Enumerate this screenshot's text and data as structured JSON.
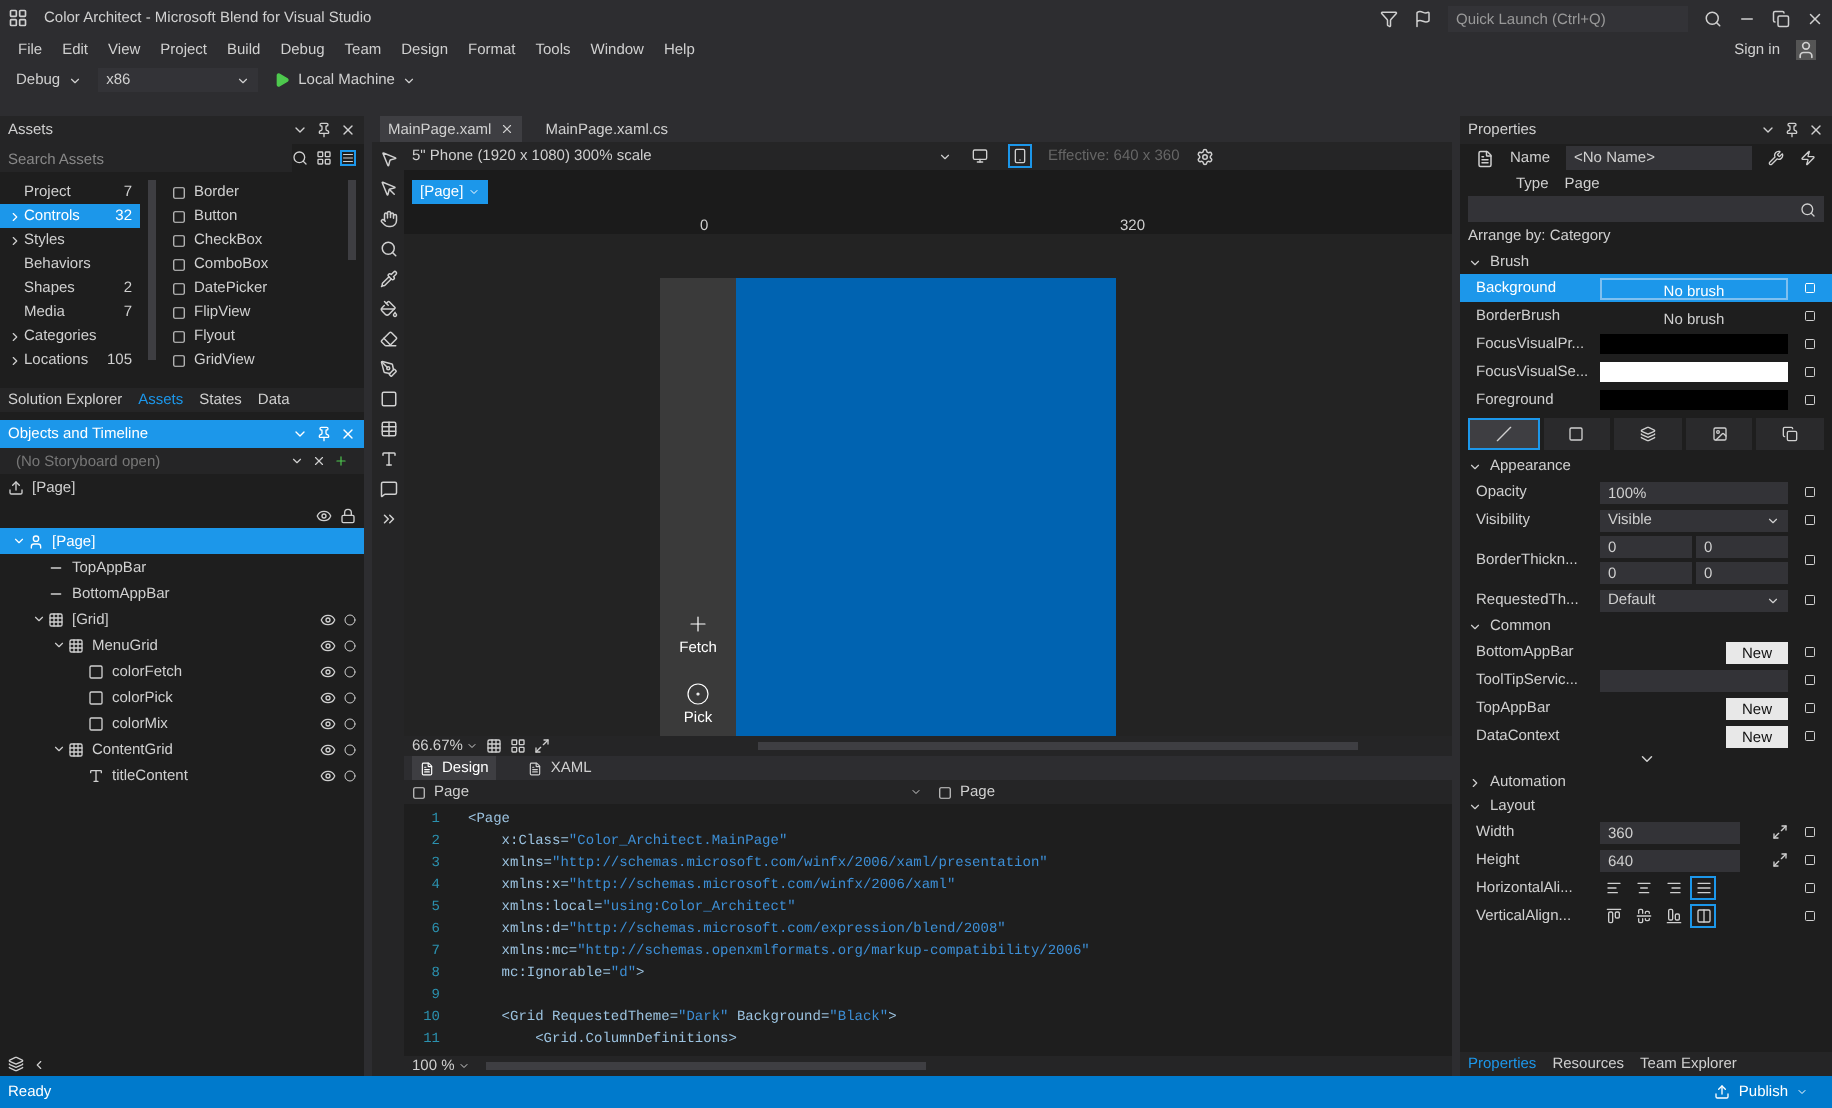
{
  "window": {
    "title": "Color Architect - Microsoft Blend for Visual Studio",
    "quick_launch_placeholder": "Quick Launch (Ctrl+Q)",
    "sign_in": "Sign in"
  },
  "menu": [
    "File",
    "Edit",
    "View",
    "Project",
    "Build",
    "Debug",
    "Team",
    "Design",
    "Format",
    "Tools",
    "Window",
    "Help"
  ],
  "toolbar": {
    "configuration": "Debug",
    "platform": "x86",
    "run_target": "Local Machine"
  },
  "assets": {
    "title": "Assets",
    "search_placeholder": "Search Assets",
    "categories": [
      {
        "label": "Project",
        "count": "7",
        "expandable": false,
        "selected": false
      },
      {
        "label": "Controls",
        "count": "32",
        "expandable": true,
        "selected": true
      },
      {
        "label": "Styles",
        "expandable": true,
        "selected": false
      },
      {
        "label": "Behaviors",
        "expandable": false,
        "selected": false
      },
      {
        "label": "Shapes",
        "count": "2",
        "expandable": false,
        "selected": false
      },
      {
        "label": "Media",
        "count": "7",
        "expandable": false,
        "selected": false
      },
      {
        "label": "Categories",
        "expandable": true,
        "selected": false
      },
      {
        "label": "Locations",
        "count": "105",
        "expandable": true,
        "selected": false
      }
    ],
    "items": [
      "Border",
      "Button",
      "CheckBox",
      "ComboBox",
      "DatePicker",
      "FlipView",
      "Flyout",
      "GridView"
    ],
    "tabs": [
      {
        "label": "Solution Explorer",
        "selected": false
      },
      {
        "label": "Assets",
        "selected": true
      },
      {
        "label": "States",
        "selected": false
      },
      {
        "label": "Data",
        "selected": false
      }
    ]
  },
  "objects": {
    "title": "Objects and Timeline",
    "storyboard": "(No Storyboard open)",
    "scope": "[Page]",
    "tree": [
      {
        "label": "[Page]",
        "kind": "page",
        "selected": true,
        "children": [
          {
            "label": "TopAppBar",
            "kind": "property",
            "selected": false
          },
          {
            "label": "BottomAppBar",
            "kind": "property",
            "selected": false
          },
          {
            "label": "[Grid]",
            "kind": "grid",
            "selected": false,
            "children": [
              {
                "label": "MenuGrid",
                "kind": "grid",
                "selected": false,
                "children": [
                  {
                    "label": "colorFetch",
                    "kind": "button",
                    "selected": false
                  },
                  {
                    "label": "colorPick",
                    "kind": "button",
                    "selected": false
                  },
                  {
                    "label": "colorMix",
                    "kind": "button",
                    "selected": false
                  }
                ]
              },
              {
                "label": "ContentGrid",
                "kind": "grid",
                "selected": false,
                "children": [
                  {
                    "label": "titleContent",
                    "kind": "text",
                    "selected": false
                  }
                ]
              }
            ]
          }
        ]
      }
    ]
  },
  "document_tabs": [
    {
      "label": "MainPage.xaml",
      "selected": true
    },
    {
      "label": "MainPage.xaml.cs",
      "selected": false
    }
  ],
  "designer": {
    "device": "5\" Phone (1920 x 1080) 300% scale",
    "orientations": [
      {
        "kind": "landscape",
        "selected": false
      },
      {
        "kind": "portrait",
        "selected": true
      }
    ],
    "effective": "Effective: 640 x 360",
    "element": "[Page]",
    "ruler": [
      "0",
      "320"
    ],
    "app_bar": [
      {
        "label": "Fetch",
        "kind": "add"
      },
      {
        "label": "Pick",
        "kind": "target"
      }
    ],
    "zoom": "66.67%"
  },
  "view_tabs": [
    {
      "label": "Design",
      "selected": true
    },
    {
      "label": "XAML",
      "selected": false
    }
  ],
  "code": {
    "scope_left": "Page",
    "scope_right": "Page",
    "zoom": "100 %",
    "lines": [
      {
        "number": "1",
        "text": "<Page"
      },
      {
        "number": "2",
        "text": "    x:Class=\"Color_Architect.MainPage\""
      },
      {
        "number": "3",
        "text": "    xmlns=\"http://schemas.microsoft.com/winfx/2006/xaml/presentation\""
      },
      {
        "number": "4",
        "text": "    xmlns:x=\"http://schemas.microsoft.com/winfx/2006/xaml\""
      },
      {
        "number": "5",
        "text": "    xmlns:local=\"using:Color_Architect\""
      },
      {
        "number": "6",
        "text": "    xmlns:d=\"http://schemas.microsoft.com/expression/blend/2008\""
      },
      {
        "number": "7",
        "text": "    xmlns:mc=\"http://schemas.openxmlformats.org/markup-compatibility/2006\""
      },
      {
        "number": "8",
        "text": "    mc:Ignorable=\"d\">"
      },
      {
        "number": "9"
      },
      {
        "number": "10",
        "text": "    <Grid RequestedTheme=\"Dark\" Background=\"Black\">"
      },
      {
        "number": "11",
        "text": "        <Grid.ColumnDefinitions>"
      }
    ]
  },
  "properties": {
    "title": "Properties",
    "name_label": "Name",
    "name_value": "<No Name>",
    "type_label": "Type",
    "type_value": "Page",
    "arrange": "Arrange by: Category",
    "sections": [
      {
        "title": "Brush",
        "expanded": true,
        "rows": [
          {
            "label": "Background",
            "kind": "text",
            "value": "No brush",
            "selected": true
          },
          {
            "label": "BorderBrush",
            "kind": "text",
            "value": "No brush",
            "selected": false
          },
          {
            "label": "FocusVisualPr...",
            "kind": "swatch",
            "color": "#000000",
            "selected": false
          },
          {
            "label": "FocusVisualSe...",
            "kind": "swatch",
            "color": "#ffffff",
            "selected": false
          },
          {
            "label": "Foreground",
            "kind": "swatch",
            "color": "#000000",
            "selected": false
          }
        ],
        "brush_tabs": [
          {
            "kind": "none",
            "selected": true
          },
          {
            "kind": "solid",
            "selected": false
          },
          {
            "kind": "gradient",
            "selected": false
          },
          {
            "kind": "image",
            "selected": false
          },
          {
            "kind": "resource",
            "selected": false
          }
        ]
      },
      {
        "title": "Appearance",
        "expanded": true,
        "rows": [
          {
            "label": "Opacity",
            "kind": "field",
            "value": "100%"
          },
          {
            "label": "Visibility",
            "kind": "dropdown",
            "value": "Visible"
          },
          {
            "label": "BorderThickn...",
            "kind": "thickness",
            "values": [
              "0",
              "0",
              "0",
              "0"
            ]
          },
          {
            "label": "RequestedTh...",
            "kind": "dropdown",
            "value": "Default"
          }
        ]
      },
      {
        "title": "Common",
        "expanded": true,
        "more": true,
        "rows": [
          {
            "label": "BottomAppBar",
            "kind": "button",
            "value": "New"
          },
          {
            "label": "ToolTipServic...",
            "kind": "field"
          },
          {
            "label": "TopAppBar",
            "kind": "button",
            "value": "New"
          },
          {
            "label": "DataContext",
            "kind": "button",
            "value": "New"
          }
        ]
      },
      {
        "title": "Automation",
        "expanded": false
      },
      {
        "title": "Layout",
        "expanded": true,
        "rows": [
          {
            "label": "Width",
            "kind": "size",
            "value": "360"
          },
          {
            "label": "Height",
            "kind": "size",
            "value": "640"
          },
          {
            "label": "HorizontalAli...",
            "kind": "align",
            "options": [
              {
                "kind": "left",
                "selected": false
              },
              {
                "kind": "center",
                "selected": false
              },
              {
                "kind": "right",
                "selected": false
              },
              {
                "kind": "stretch",
                "selected": true
              }
            ]
          },
          {
            "label": "VerticalAlign...",
            "kind": "align",
            "options": [
              {
                "kind": "top",
                "selected": false
              },
              {
                "kind": "middle",
                "selected": false
              },
              {
                "kind": "bottom",
                "selected": false
              },
              {
                "kind": "vstretch",
                "selected": true
              }
            ]
          }
        ]
      }
    ],
    "tabs": [
      {
        "label": "Properties",
        "selected": true
      },
      {
        "label": "Resources",
        "selected": false
      },
      {
        "label": "Team Explorer",
        "selected": false
      }
    ]
  },
  "status_bar": {
    "text": "Ready",
    "publish": "Publish"
  }
}
